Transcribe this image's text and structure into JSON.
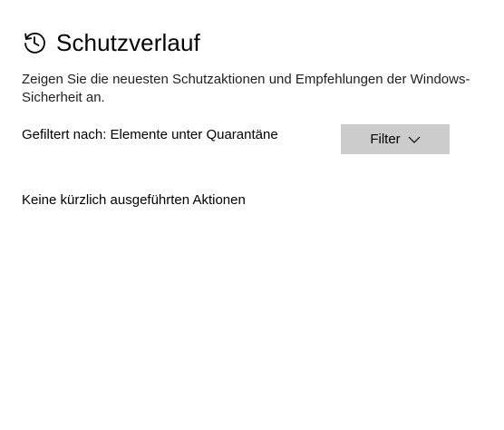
{
  "header": {
    "icon": "history-icon",
    "title": "Schutzverlauf"
  },
  "description": "Zeigen Sie die neuesten Schutzaktionen und Empfehlungen der Windows-Sicherheit an.",
  "filter": {
    "label": "Gefiltert nach: Elemente unter Quarantäne",
    "button_label": "Filter",
    "button_icon": "chevron-down-icon"
  },
  "empty_message": "Keine kürzlich ausgeführten Aktionen",
  "colors": {
    "background": "#ffffff",
    "button_background": "#cccccc",
    "text": "#000000"
  }
}
